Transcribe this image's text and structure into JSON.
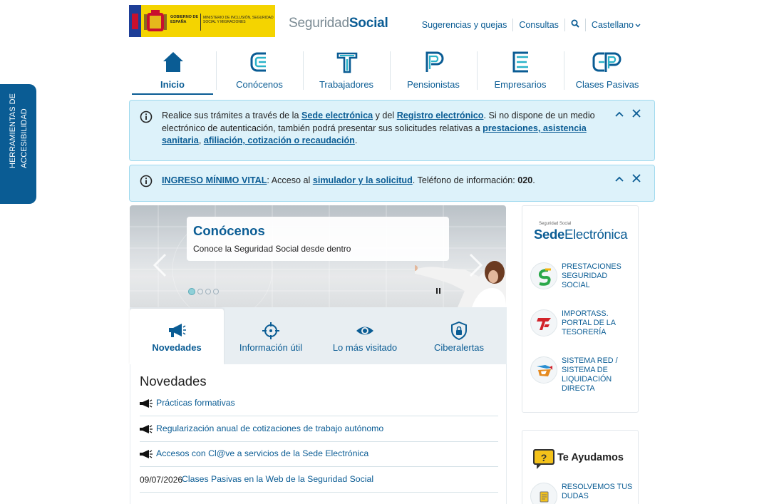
{
  "accessibility": {
    "label_line1": "HERRAMIENTAS DE",
    "label_line2": "ACCESIBILIDAD"
  },
  "header": {
    "gov_text": "GOBIERNO DE ESPAÑA",
    "ministry_text": "MINISTERIO DE INCLUSIÓN, SEGURIDAD SOCIAL Y MIGRACIONES",
    "brand_light": "Seguridad",
    "brand_bold": "Social",
    "links": {
      "suggestions": "Sugerencias y quejas",
      "consultas": "Consultas",
      "language": "Castellano"
    }
  },
  "main_nav": [
    {
      "label": "Inicio",
      "icon": "home-icon"
    },
    {
      "label": "Conócenos",
      "icon": "c-letter-icon"
    },
    {
      "label": "Trabajadores",
      "icon": "t-letter-icon"
    },
    {
      "label": "Pensionistas",
      "icon": "p-letter-icon"
    },
    {
      "label": "Empresarios",
      "icon": "e-letter-icon"
    },
    {
      "label": "Clases Pasivas",
      "icon": "cp-letters-icon"
    }
  ],
  "alerts": {
    "first": {
      "t1": "Realice sus trámites a través de la ",
      "link1": "Sede electrónica",
      "t2": " y del ",
      "link2": "Registro electrónico",
      "t3": ". Si no dispone de un medio electrónico de autenticación, también podrá presentar sus solicitudes relativas a ",
      "link3": "prestaciones, asistencia sanitaria",
      "t4": ", ",
      "link4": "afiliación, cotización o recaudación",
      "t5": "."
    },
    "second": {
      "link1": "INGRESO MÍNIMO VITAL",
      "t1": ": Acceso al ",
      "link2": "simulador y la solicitud",
      "t2": ".  Teléfono de información: ",
      "phone": "020",
      "t3": "."
    }
  },
  "carousel": {
    "title": "Conócenos",
    "subtitle": "Conoce la Seguridad Social desde dentro",
    "slides": 4,
    "active_slide": 1
  },
  "tabs": [
    {
      "label": "Novedades",
      "icon": "megaphone-icon"
    },
    {
      "label": "Información útil",
      "icon": "crosshair-icon"
    },
    {
      "label": "Lo más visitado",
      "icon": "eye-icon"
    },
    {
      "label": "Ciberalertas",
      "icon": "shield-lock-icon"
    }
  ],
  "news": {
    "title": "Novedades",
    "items": [
      {
        "text": "Prácticas formativas"
      },
      {
        "text": "Regularización anual de cotizaciones de trabajo autónomo"
      },
      {
        "text": "Accesos con Cl@ve a servicios de la Sede Electrónica"
      },
      {
        "date": "09/07/2026",
        "text": "Clases Pasivas en la Web de la Seguridad Social"
      }
    ]
  },
  "sidebar": {
    "sede": {
      "small": "Seguridad Social",
      "bold": "Sede",
      "light": "Electrónica"
    },
    "links": [
      {
        "text": "PRESTACIONES SEGURIDAD SOCIAL"
      },
      {
        "text": "IMPORTASS. PORTAL DE LA TESORERÍA"
      },
      {
        "text": "SISTEMA RED / SISTEMA DE LIQUIDACIÓN DIRECTA"
      }
    ],
    "help": {
      "title": "Te Ayudamos",
      "link": "RESOLVEMOS TUS DUDAS"
    }
  },
  "colors": {
    "brand": "#0a5c94",
    "alert_bg": "#ddf2fa",
    "teal": "#2ab3c9"
  }
}
